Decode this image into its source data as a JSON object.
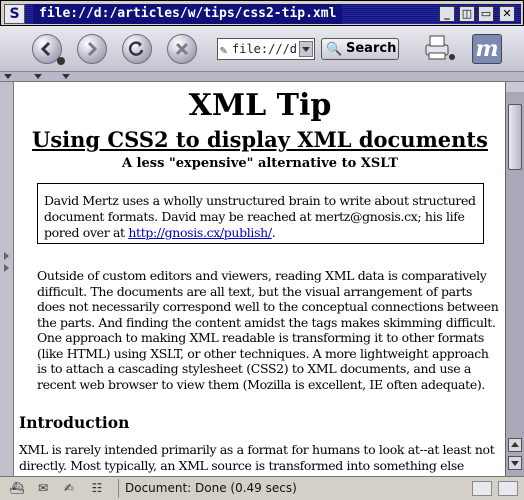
{
  "window": {
    "title": "file://d:/articles/w/tips/css2-tip.xml",
    "logo_glyph": "S",
    "buttons": {
      "minimize": "_",
      "restore": "▭",
      "iconify": "◫",
      "close": "✕"
    }
  },
  "toolbar": {
    "back": "back-icon",
    "forward": "forward-icon",
    "reload": "reload-icon",
    "stop": "stop-icon",
    "url_value": "file:///d:/",
    "search_label": "Search",
    "m_logo": "m"
  },
  "document": {
    "title": "XML Tip",
    "subtitle": "Using CSS2 to display XML documents",
    "tagline": "A less \"expensive\" alternative to XSLT",
    "bio_text": "David Mertz uses a wholly unstructured brain to write about structured document formats. David may be reached at mertz@gnosis.cx; his life pored over at ",
    "bio_link": "http://gnosis.cx/publish/",
    "bio_end": ".",
    "abstract": "Outside of custom editors and viewers, reading XML data is comparatively difficult. The documents are all text, but the visual arrangement of parts does not necessarily correspond well to the conceptual connections between the parts. And finding the content amidst the tags makes skimming difficult. One approach to making XML readable is transforming it to other formats (like HTML) using XSLT, or other techniques. A more lightweight approach is to attach a cascading stylesheet (CSS2) to XML documents, and use a recent web browser to view them (Mozilla is excellent, IE often adequate).",
    "intro_heading": "Introduction",
    "intro_text": "XML is rarely intended primarily as a format for humans to look at--at least not directly. Most typically, an XML source is transformed into something else before it"
  },
  "status": {
    "text": "Document: Done (0.49 secs)"
  }
}
